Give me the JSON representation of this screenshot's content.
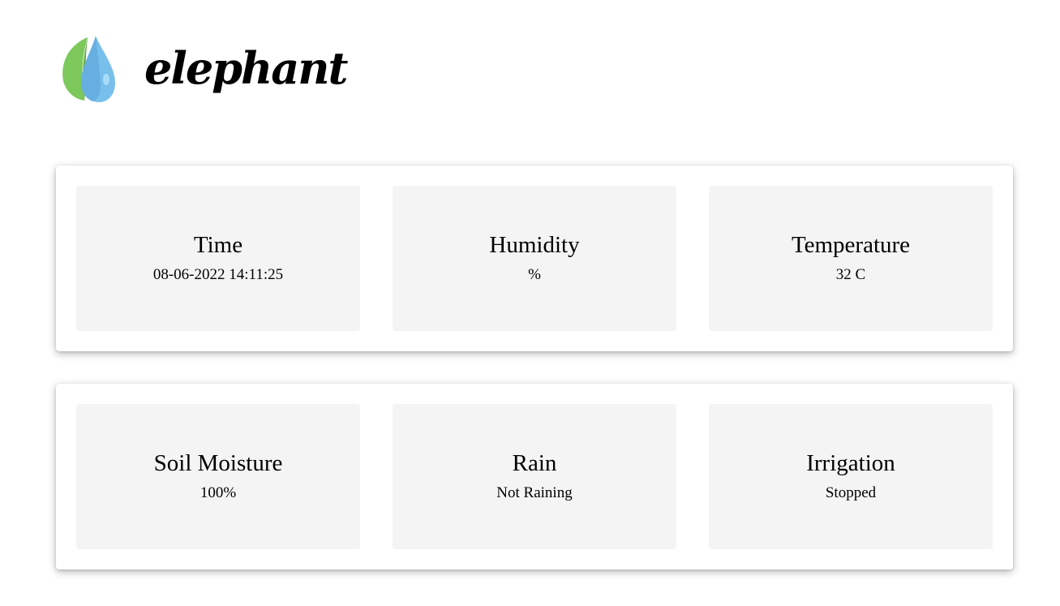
{
  "header": {
    "brand": "elephant",
    "logo_icon": "leaf-water-drop-icon",
    "colors": {
      "leaf": "#7cc85b",
      "leaf_dark": "#6aab4d",
      "drop": "#78bfec",
      "drop_dark": "#5aa3d8"
    }
  },
  "row1": [
    {
      "title": "Time",
      "value": "08-06-2022 14:11:25"
    },
    {
      "title": "Humidity",
      "value": "%"
    },
    {
      "title": "Temperature",
      "value": "32 C"
    }
  ],
  "row2": [
    {
      "title": "Soil Moisture",
      "value": "100%"
    },
    {
      "title": "Rain",
      "value": "Not Raining"
    },
    {
      "title": "Irrigation",
      "value": "Stopped"
    }
  ]
}
